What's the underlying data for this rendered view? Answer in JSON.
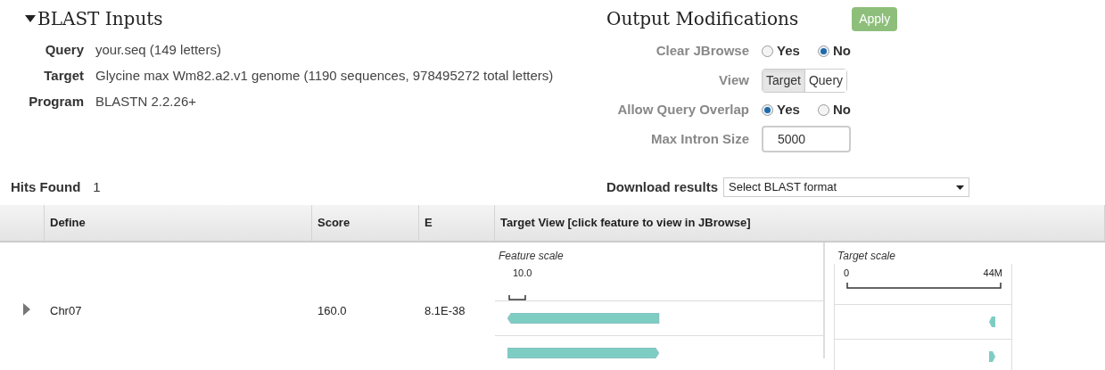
{
  "inputs": {
    "title": "BLAST Inputs",
    "expanded": true,
    "fields": [
      {
        "label": "Query",
        "value": "your.seq (149 letters)"
      },
      {
        "label": "Target",
        "value": "Glycine max Wm82.a2.v1 genome (1190 sequences, 978495272 total letters)"
      },
      {
        "label": "Program",
        "value": "BLASTN 2.2.26+"
      }
    ]
  },
  "output_modifications": {
    "title": "Output Modifications",
    "apply_button": "Apply",
    "options": [
      {
        "kind": "radio",
        "label": "Clear JBrowse",
        "choices": [
          {
            "label": "Yes",
            "selected": false
          },
          {
            "label": "No",
            "selected": true
          }
        ]
      },
      {
        "kind": "toggle",
        "label": "View",
        "choices": [
          {
            "label": "Target",
            "selected": true
          },
          {
            "label": "Query",
            "selected": false
          }
        ]
      },
      {
        "kind": "radio",
        "label": "Allow Query Overlap",
        "choices": [
          {
            "label": "Yes",
            "selected": true
          },
          {
            "label": "No",
            "selected": false
          }
        ]
      },
      {
        "kind": "input",
        "label": "Max Intron Size",
        "value": "5000"
      }
    ]
  },
  "hits_found": {
    "label": "Hits Found",
    "value": "1"
  },
  "download": {
    "label": "Download results",
    "placeholder": "Select BLAST format"
  },
  "table": {
    "columns": [
      "Define",
      "Score",
      "E",
      "Target View [click feature to view in JBrowse]"
    ],
    "rows": [
      {
        "expanded": false,
        "define": "Chr07",
        "score": "160.0",
        "e": "8.1E-38",
        "feature_scale": {
          "label": "Feature scale",
          "tick": "10.0"
        },
        "target_scale": {
          "label": "Target scale",
          "start": "0",
          "end": "44M"
        },
        "features": [
          {
            "kind": "reverse"
          },
          {
            "kind": "forward"
          }
        ]
      }
    ]
  }
}
